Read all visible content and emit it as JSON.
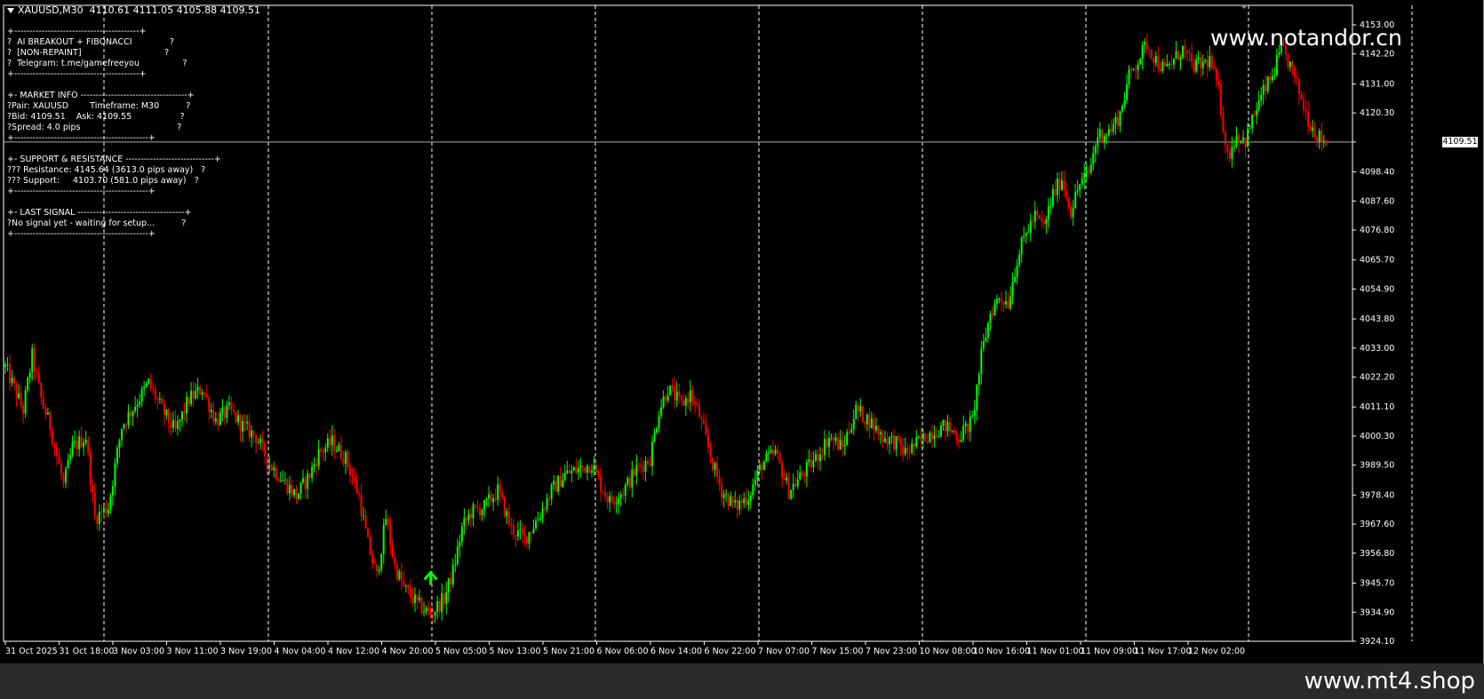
{
  "header": {
    "symbol": "XAUUSD,M30",
    "ohlc": "4110.61 4111.05 4105.88 4109.51"
  },
  "info_panel": {
    "lines": [
      "+-----------------------------------------+",
      "?  AI BREAKOUT + FIBONACCI              ?",
      "?  [NON-REPAINT]                               ?",
      "?  Telegram: t.me/gamefreeyou                ?",
      "+-----------------------------------------+",
      "",
      "+- MARKET INFO -----------------------------------+",
      "?Pair: XAUUSD        Timeframe: M30          ?",
      "?Bid: 4109.51    Ask: 4109.55                  ?",
      "?Spread: 4.0 pips                                    ?",
      "+--------------------------------------------+",
      "",
      "+- SUPPORT & RESISTANCE -----------------------------+",
      "??? Resistance: 4145.64 (3613.0 pips away)   ?",
      "??? Support:     4103.70 (581.0 pips away)   ?",
      "+--------------------------------------------+",
      "",
      "+- LAST SIGNAL -----------------------------------+",
      "?No signal yet - waiting for setup...          ?",
      "+--------------------------------------------+"
    ]
  },
  "watermarks": {
    "top": "www.notandor.cn",
    "bottom": "www.mt4.shop"
  },
  "current_price": "4109.51",
  "colors": {
    "background": "#000000",
    "bull": "#00ff00",
    "bear": "#ff0000",
    "grid": "#ffffff",
    "signal_arrow": "#00ff00"
  },
  "chart_data": {
    "type": "candlestick",
    "symbol": "XAUUSD",
    "timeframe": "M30",
    "y_ticks": [
      "4153.00",
      "4142.20",
      "4131.00",
      "4120.30",
      "4109.51",
      "4098.40",
      "4087.60",
      "4076.80",
      "4065.70",
      "4054.90",
      "4043.80",
      "4033.00",
      "4022.20",
      "4011.10",
      "4000.30",
      "3989.50",
      "3978.40",
      "3967.60",
      "3956.80",
      "3945.70",
      "3934.90",
      "3924.10"
    ],
    "ylim": [
      3924.1,
      4153.0
    ],
    "x_labels": [
      "31 Oct 2025",
      "31 Oct 18:00",
      "3 Nov 03:00",
      "3 Nov 11:00",
      "3 Nov 19:00",
      "4 Nov 04:00",
      "4 Nov 12:00",
      "4 Nov 20:00",
      "5 Nov 05:00",
      "5 Nov 13:00",
      "5 Nov 21:00",
      "6 Nov 06:00",
      "6 Nov 14:00",
      "6 Nov 22:00",
      "7 Nov 07:00",
      "7 Nov 15:00",
      "7 Nov 23:00",
      "10 Nov 08:00",
      "10 Nov 16:00",
      "11 Nov 01:00",
      "11 Nov 09:00",
      "11 Nov 17:00",
      "12 Nov 02:00"
    ],
    "day_separators": [
      "31 Oct 18:00",
      "3 Nov 19:00",
      "4 Nov 20:00",
      "5 Nov 21:00",
      "6 Nov 22:00",
      "7 Nov 23:00",
      "10 Nov 16:00",
      "11 Nov 17:00",
      "12 Nov 02:00"
    ],
    "close_path": [
      [
        0,
        4026
      ],
      [
        4,
        4018
      ],
      [
        8,
        4010
      ],
      [
        12,
        4030
      ],
      [
        16,
        4014
      ],
      [
        20,
        4004
      ],
      [
        26,
        3982
      ],
      [
        30,
        3996
      ],
      [
        36,
        4000
      ],
      [
        40,
        3970
      ],
      [
        46,
        3974
      ],
      [
        52,
        4004
      ],
      [
        58,
        4012
      ],
      [
        64,
        4020
      ],
      [
        70,
        4010
      ],
      [
        76,
        4002
      ],
      [
        82,
        4014
      ],
      [
        88,
        4018
      ],
      [
        94,
        4006
      ],
      [
        100,
        4010
      ],
      [
        106,
        4004
      ],
      [
        112,
        4000
      ],
      [
        118,
        3990
      ],
      [
        124,
        3984
      ],
      [
        130,
        3978
      ],
      [
        136,
        3986
      ],
      [
        140,
        3994
      ],
      [
        146,
        3998
      ],
      [
        152,
        3992
      ],
      [
        158,
        3978
      ],
      [
        162,
        3960
      ],
      [
        166,
        3948
      ],
      [
        170,
        3970
      ],
      [
        174,
        3952
      ],
      [
        178,
        3944
      ],
      [
        184,
        3938
      ],
      [
        190,
        3934
      ],
      [
        196,
        3940
      ],
      [
        200,
        3950
      ],
      [
        204,
        3966
      ],
      [
        208,
        3972
      ],
      [
        214,
        3974
      ],
      [
        220,
        3980
      ],
      [
        226,
        3966
      ],
      [
        232,
        3962
      ],
      [
        238,
        3970
      ],
      [
        244,
        3980
      ],
      [
        250,
        3986
      ],
      [
        256,
        3988
      ],
      [
        262,
        3990
      ],
      [
        266,
        3982
      ],
      [
        270,
        3976
      ],
      [
        276,
        3980
      ],
      [
        282,
        3988
      ],
      [
        288,
        3992
      ],
      [
        292,
        4010
      ],
      [
        296,
        4018
      ],
      [
        302,
        4012
      ],
      [
        306,
        4016
      ],
      [
        310,
        4008
      ],
      [
        316,
        3990
      ],
      [
        320,
        3980
      ],
      [
        326,
        3974
      ],
      [
        332,
        3978
      ],
      [
        338,
        3990
      ],
      [
        344,
        3994
      ],
      [
        350,
        3980
      ],
      [
        356,
        3986
      ],
      [
        362,
        3992
      ],
      [
        368,
        4000
      ],
      [
        374,
        3996
      ],
      [
        380,
        4010
      ],
      [
        386,
        4006
      ],
      [
        392,
        4000
      ],
      [
        398,
        3998
      ],
      [
        402,
        3994
      ],
      [
        408,
        3998
      ],
      [
        414,
        4002
      ],
      [
        420,
        4004
      ],
      [
        426,
        4000
      ],
      [
        432,
        4006
      ],
      [
        436,
        4030
      ],
      [
        440,
        4046
      ],
      [
        444,
        4052
      ],
      [
        448,
        4050
      ],
      [
        452,
        4066
      ],
      [
        456,
        4076
      ],
      [
        460,
        4082
      ],
      [
        464,
        4078
      ],
      [
        468,
        4090
      ],
      [
        472,
        4096
      ],
      [
        476,
        4084
      ],
      [
        480,
        4094
      ],
      [
        484,
        4098
      ],
      [
        488,
        4112
      ],
      [
        494,
        4114
      ],
      [
        498,
        4120
      ],
      [
        502,
        4134
      ],
      [
        506,
        4140
      ],
      [
        510,
        4146
      ],
      [
        514,
        4140
      ],
      [
        518,
        4136
      ],
      [
        522,
        4140
      ],
      [
        526,
        4144
      ],
      [
        530,
        4138
      ],
      [
        534,
        4138
      ],
      [
        538,
        4140
      ],
      [
        542,
        4128
      ],
      [
        546,
        4104
      ],
      [
        550,
        4112
      ],
      [
        554,
        4110
      ],
      [
        558,
        4120
      ],
      [
        562,
        4128
      ],
      [
        566,
        4134
      ],
      [
        570,
        4144
      ],
      [
        574,
        4138
      ],
      [
        578,
        4128
      ],
      [
        582,
        4118
      ],
      [
        586,
        4112
      ],
      [
        590,
        4109.51
      ]
    ],
    "signal": {
      "type": "buy-arrow",
      "bar": 190,
      "price": 3947
    }
  }
}
